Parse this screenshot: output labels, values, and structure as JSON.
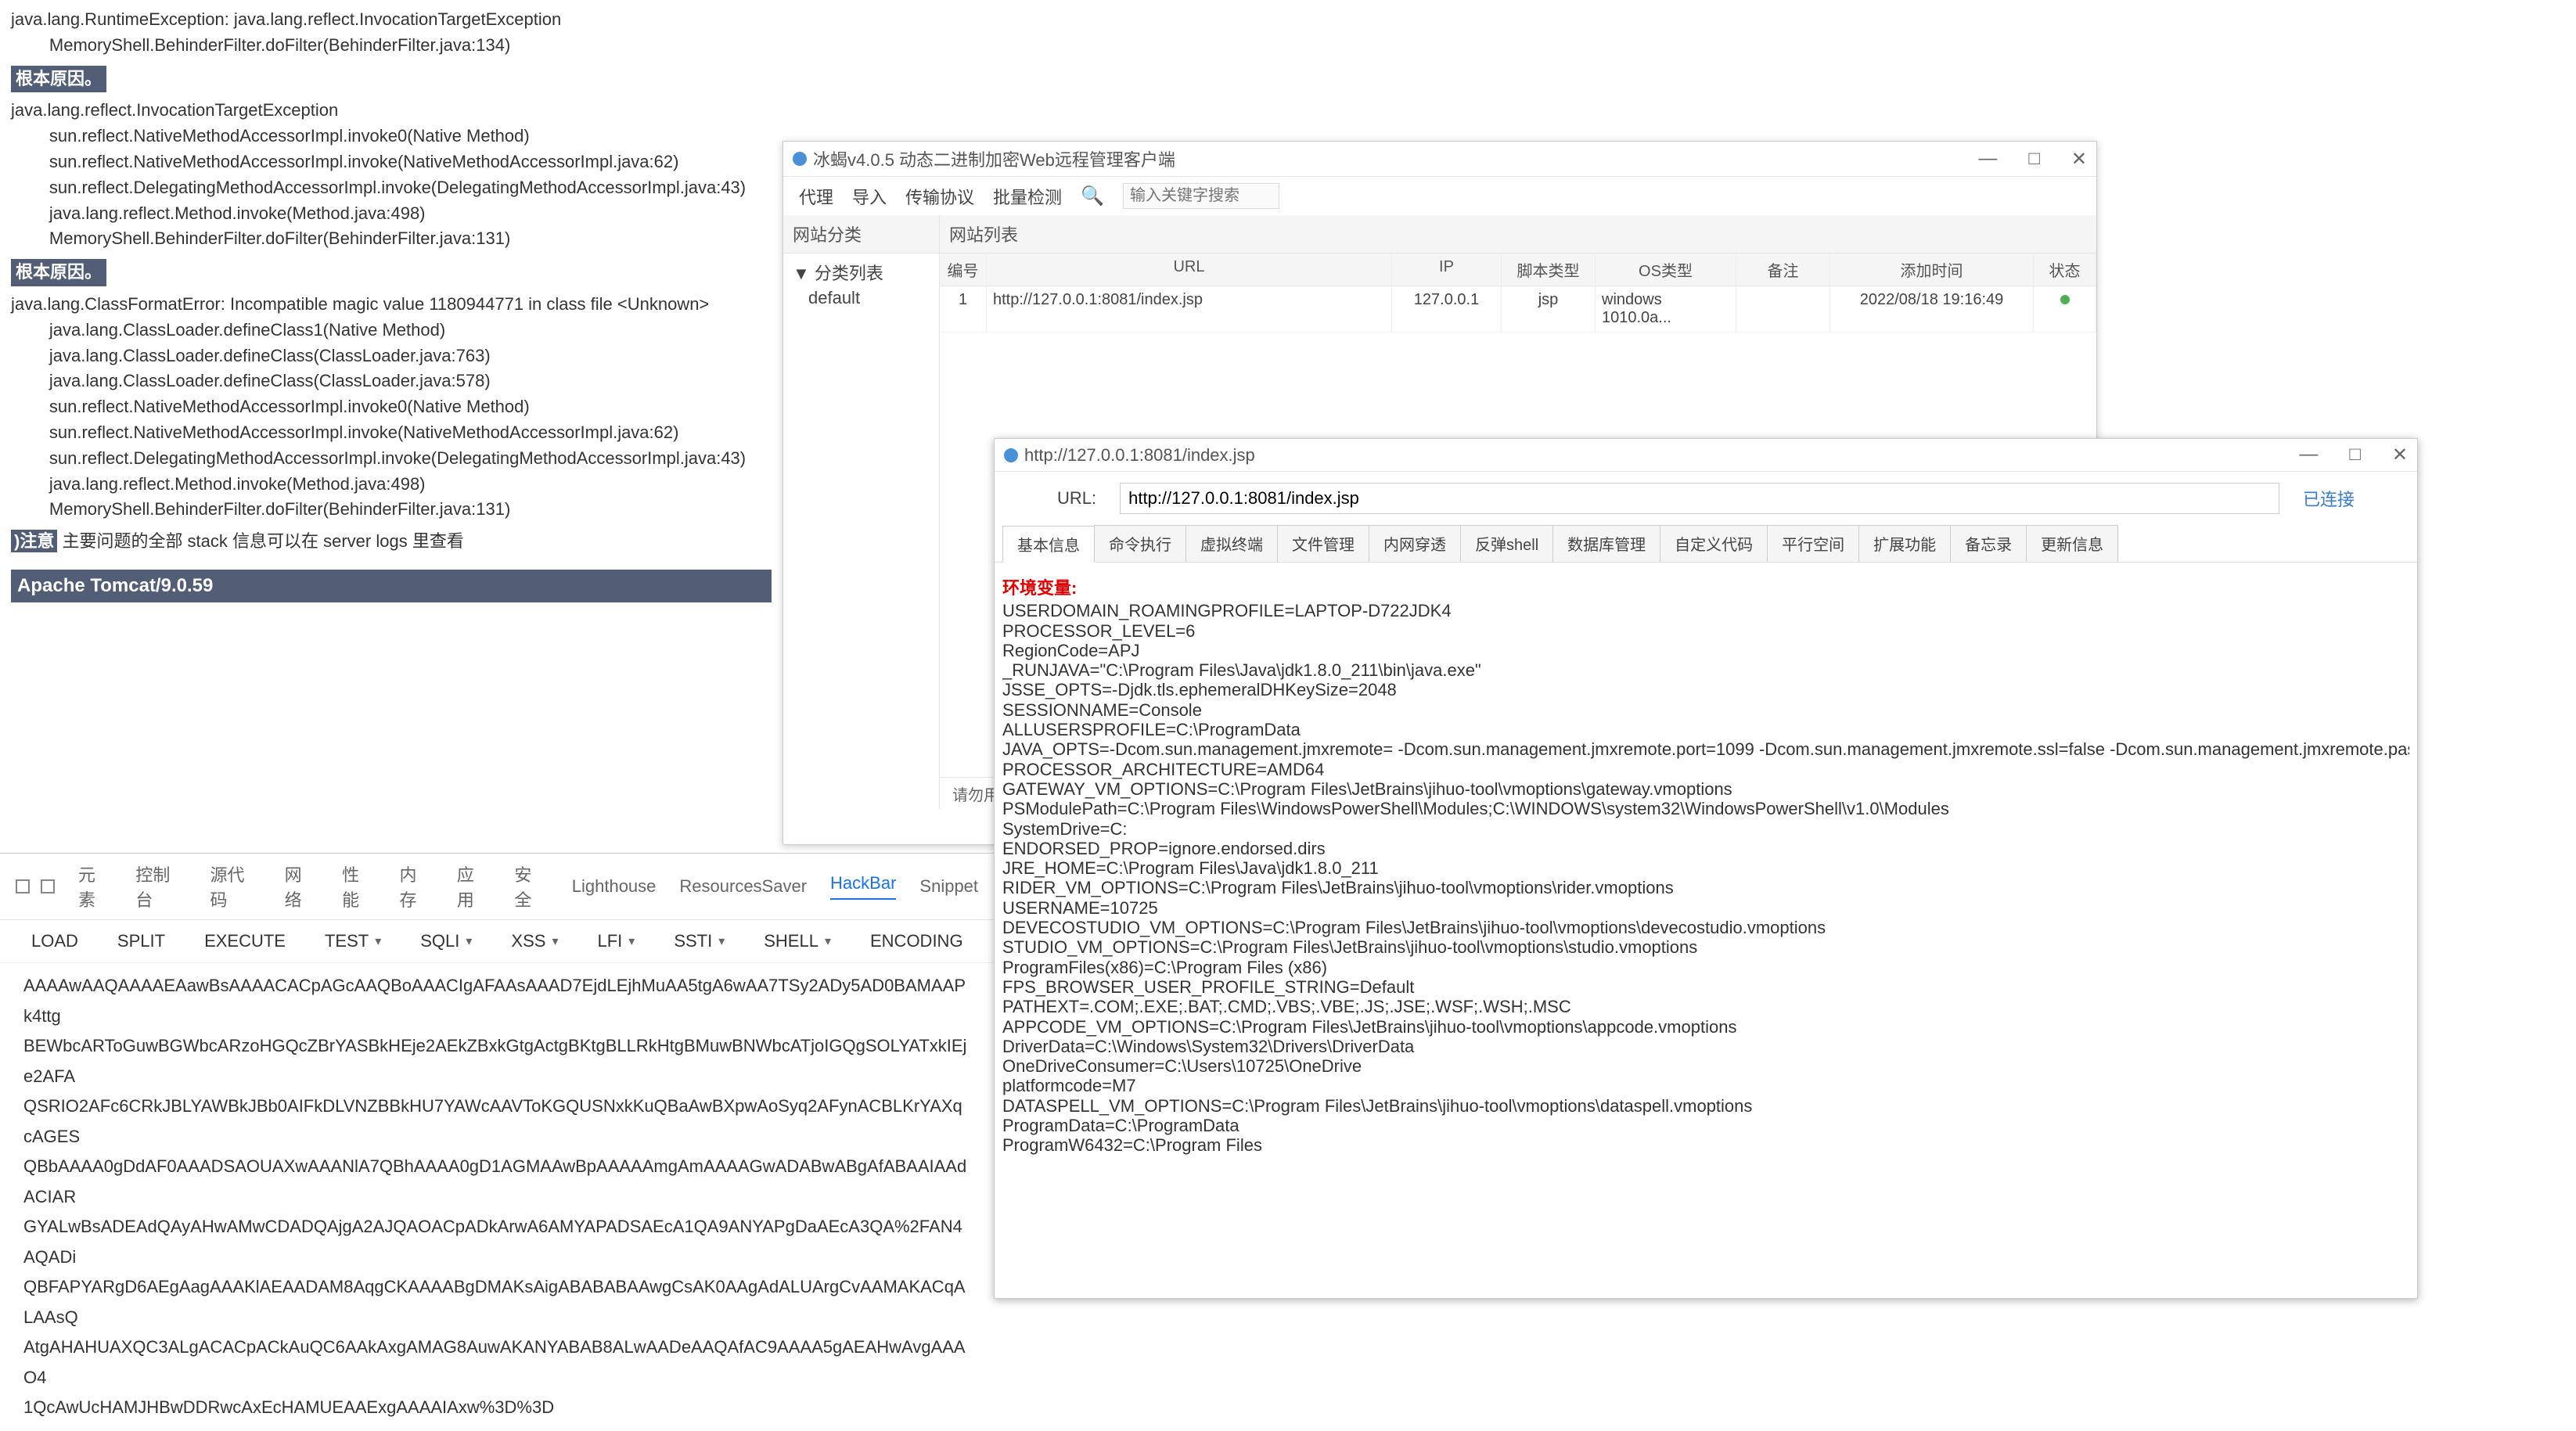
{
  "tomcat": {
    "err1_l1": "java.lang.RuntimeException: java.lang.reflect.InvocationTargetException",
    "err1_l2": "        MemoryShell.BehinderFilter.doFilter(BehinderFilter.java:134)",
    "root_cause": "根本原因。",
    "err2_l1": "java.lang.reflect.InvocationTargetException",
    "err2_l2": "        sun.reflect.NativeMethodAccessorImpl.invoke0(Native Method)",
    "err2_l3": "        sun.reflect.NativeMethodAccessorImpl.invoke(NativeMethodAccessorImpl.java:62)",
    "err2_l4": "        sun.reflect.DelegatingMethodAccessorImpl.invoke(DelegatingMethodAccessorImpl.java:43)",
    "err2_l5": "        java.lang.reflect.Method.invoke(Method.java:498)",
    "err2_l6": "        MemoryShell.BehinderFilter.doFilter(BehinderFilter.java:131)",
    "err3_l1": "java.lang.ClassFormatError: Incompatible magic value 1180944771 in class file <Unknown>",
    "err3_l2": "        java.lang.ClassLoader.defineClass1(Native Method)",
    "err3_l3": "        java.lang.ClassLoader.defineClass(ClassLoader.java:763)",
    "err3_l4": "        java.lang.ClassLoader.defineClass(ClassLoader.java:578)",
    "err3_l5": "        sun.reflect.NativeMethodAccessorImpl.invoke0(Native Method)",
    "err3_l6": "        sun.reflect.NativeMethodAccessorImpl.invoke(NativeMethodAccessorImpl.java:62)",
    "err3_l7": "        sun.reflect.DelegatingMethodAccessorImpl.invoke(DelegatingMethodAccessorImpl.java:43)",
    "err3_l8": "        java.lang.reflect.Method.invoke(Method.java:498)",
    "err3_l9": "        MemoryShell.BehinderFilter.doFilter(BehinderFilter.java:131)",
    "note_label": ")注意",
    "note_text": " 主要问题的全部 stack 信息可以在 server logs 里查看",
    "version": "Apache Tomcat/9.0.59"
  },
  "behinder": {
    "title": "冰蝎v4.0.5 动态二进制加密Web远程管理客户端",
    "menu_proxy": "代理",
    "menu_import": "导入",
    "menu_protocol": "传输协议",
    "menu_batch": "批量检测",
    "search_placeholder": "输入关键字搜索",
    "side_cat": "网站分类",
    "side_tree_root": "▼ 分类列表",
    "side_default": "default",
    "list_head": "网站列表",
    "col_id": "编号",
    "col_url": "URL",
    "col_ip": "IP",
    "col_type": "脚本类型",
    "col_os": "OS类型",
    "col_note": "备注",
    "col_time": "添加时间",
    "col_status": "状态",
    "row": {
      "id": "1",
      "url": "http://127.0.0.1:8081/index.jsp",
      "ip": "127.0.0.1",
      "type": "jsp",
      "os": "windows 1010.0a...",
      "note": "",
      "time": "2022/08/18 19:16:49"
    },
    "status_bar": "请勿用于非法用途",
    "win_min": "—",
    "win_max": "□",
    "win_close": "✕"
  },
  "shell": {
    "title": "http://127.0.0.1:8081/index.jsp",
    "url_label": "URL:",
    "url_value": "http://127.0.0.1:8081/index.jsp",
    "connected": "已连接",
    "tabs": {
      "basic": "基本信息",
      "cmd": "命令执行",
      "vterm": "虚拟终端",
      "file": "文件管理",
      "intranet": "内网穿透",
      "revshell": "反弹shell",
      "db": "数据库管理",
      "custom": "自定义代码",
      "parallel": "平行空间",
      "ext": "扩展功能",
      "memo": "备忘录",
      "update": "更新信息"
    },
    "env_header": "环境变量:",
    "env": [
      "USERDOMAIN_ROAMINGPROFILE=LAPTOP-D722JDK4",
      "PROCESSOR_LEVEL=6",
      "RegionCode=APJ",
      "_RUNJAVA=\"C:\\Program Files\\Java\\jdk1.8.0_211\\bin\\java.exe\"",
      "JSSE_OPTS=-Djdk.tls.ephemeralDHKeySize=2048",
      "SESSIONNAME=Console",
      "ALLUSERSPROFILE=C:\\ProgramData",
      "JAVA_OPTS=-Dcom.sun.management.jmxremote= -Dcom.sun.management.jmxremote.port=1099 -Dcom.sun.management.jmxremote.ssl=false -Dcom.sun.management.jmxremote.password.file=C:\\Users\\10725\\AppData\\Local\\JetBrains\\IntelliJIdea2022.2\\tomcat\\40b8917e-fde7-4542-aa96-02773d8a4176\\jmxremote.password -Dcom.sun.management.jmxremote.access.file=C:\\Users\\10725\\AppData\\Local\\JetBrains\\IntelliJIdea2022.2\\tomcat\\40b8917e-fde7-4542-aa96-02773d8a4176\\jmxremote.access -Djava.rmi.server.hostname=127.0.0.1 -Djdk.tls.ephemeralDHKeySize=2048 -Djava.protocol.handler.pkgs=org.apache.catalina.webresources",
      "PROCESSOR_ARCHITECTURE=AMD64",
      "GATEWAY_VM_OPTIONS=C:\\Program Files\\JetBrains\\jihuo-tool\\vmoptions\\gateway.vmoptions",
      "PSModulePath=C:\\Program Files\\WindowsPowerShell\\Modules;C:\\WINDOWS\\system32\\WindowsPowerShell\\v1.0\\Modules",
      "SystemDrive=C:",
      "ENDORSED_PROP=ignore.endorsed.dirs",
      "JRE_HOME=C:\\Program Files\\Java\\jdk1.8.0_211",
      "RIDER_VM_OPTIONS=C:\\Program Files\\JetBrains\\jihuo-tool\\vmoptions\\rider.vmoptions",
      "USERNAME=10725",
      "DEVECOSTUDIO_VM_OPTIONS=C:\\Program Files\\JetBrains\\jihuo-tool\\vmoptions\\devecostudio.vmoptions",
      "STUDIO_VM_OPTIONS=C:\\Program Files\\JetBrains\\jihuo-tool\\vmoptions\\studio.vmoptions",
      "ProgramFiles(x86)=C:\\Program Files (x86)",
      "FPS_BROWSER_USER_PROFILE_STRING=Default",
      "PATHEXT=.COM;.EXE;.BAT;.CMD;.VBS;.VBE;.JS;.JSE;.WSF;.WSH;.MSC",
      "APPCODE_VM_OPTIONS=C:\\Program Files\\JetBrains\\jihuo-tool\\vmoptions\\appcode.vmoptions",
      "DriverData=C:\\Windows\\System32\\Drivers\\DriverData",
      "OneDriveConsumer=C:\\Users\\10725\\OneDrive",
      "platformcode=M7",
      "DATASPELL_VM_OPTIONS=C:\\Program Files\\JetBrains\\jihuo-tool\\vmoptions\\dataspell.vmoptions",
      "ProgramData=C:\\ProgramData",
      "ProgramW6432=C:\\Program Files"
    ],
    "win_min": "—",
    "win_max": "□",
    "win_close": "✕"
  },
  "devtools": {
    "tab_elements": "元素",
    "tab_console": "控制台",
    "tab_sources": "源代码",
    "tab_network": "网络",
    "tab_performance": "性能",
    "tab_memory": "内存",
    "tab_application": "应用",
    "tab_security": "安全",
    "tab_lighthouse": "Lighthouse",
    "tab_rsaver": "ResourcesSaver",
    "tab_hackbar": "HackBar",
    "tab_snippet": "Snippet",
    "hb_load": "LOAD",
    "hb_split": "SPLIT",
    "hb_execute": "EXECUTE",
    "hb_test": "TEST",
    "hb_sqli": "SQLI",
    "hb_xss": "XSS",
    "hb_lfi": "LFI",
    "hb_ssti": "SSTI",
    "hb_shell": "SHELL",
    "hb_encoding": "ENCODING",
    "enc_l1": "AAAAwAAQAAAAEAawBsAAAACACpAGcAAQBoAAACIgAFAAsAAAD7EjdLEjhMuAA5tgA6wAA7TSy2ADy5AD0BAMAAPk4ttg",
    "enc_l2": "BEWbcARToGuwBGWbcARzoHGQcZBrYASBkHEje2AEkZBxkGtgActgBKtgBLLRkHtgBMuwBNWbcATjoIGQgSOLYATxkIEje2AFA",
    "enc_l3": "QSRIO2AFc6CRkJBLYAWBkJBb0AIFkDLVNZBBkHU7YAWcAAVToKGQUSNxkKuQBaAwBXpwAoSyq2AFynACBLKrYAXqcAGES",
    "enc_l4": "QBbAAAA0gDdAF0AAADSAOUAXwAAANlA7QBhAAAA0gD1AGMAAwBpAAAAAmgAmAAAAGwADABwABgAfABAAIAAdACIAR",
    "enc_l5": "GYALwBsADEAdQAyAHwAMwCDADQAjgA2AJQAOACpADkArwA6AMYAPADSAEcA1QA9ANYAPgDaAEcA3QA%2FAN4AQADi",
    "enc_l6": "QBFAPYARgD6AEgAagAAAKlAEAADAM8AqgCKAAAABgDMAKsAigABABABAAwgCsAK0AAgAdALUArgCvAAMAKACqALAAsQ",
    "enc_l7": "AtgAHAHUAXQC3ALgACACpACkAuQC6AAkAxgAMAG8AuwAKANYABAB8ALwAADeAAQAfAC9AAAA5gAEAHwAvgAAAO4",
    "enc_l8": "1QcAwUcHAMJHBwDDRwcAxEcHAMUEAAExgAAAAIAxw%3D%3D"
  }
}
